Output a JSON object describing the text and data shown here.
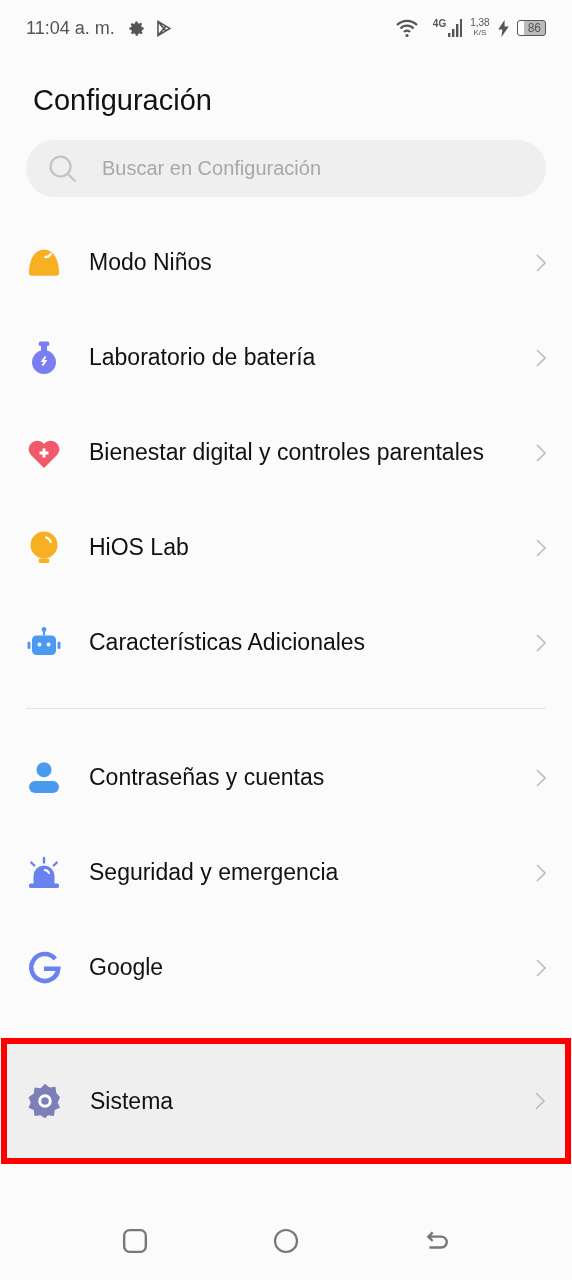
{
  "status_bar": {
    "time": "11:04 a. m.",
    "network": "4G",
    "speed_value": "1,38",
    "speed_unit": "K/S",
    "battery": "86"
  },
  "title": "Configuración",
  "search": {
    "placeholder": "Buscar en Configuración"
  },
  "groups": [
    {
      "items": [
        {
          "label": "Modo Niños",
          "kind": "kids",
          "selected": false
        },
        {
          "label": "Laboratorio de batería",
          "kind": "battery",
          "selected": false
        },
        {
          "label": "Bienestar digital y controles parentales",
          "kind": "heart",
          "selected": false
        },
        {
          "label": "HiOS Lab",
          "kind": "bulb",
          "selected": false
        },
        {
          "label": "Características Adicionales",
          "kind": "robot",
          "selected": false
        }
      ]
    },
    {
      "items": [
        {
          "label": "Contraseñas y cuentas",
          "kind": "person",
          "selected": false
        },
        {
          "label": "Seguridad y emergencia",
          "kind": "siren",
          "selected": false
        },
        {
          "label": "Google",
          "kind": "google",
          "selected": false
        }
      ]
    },
    {
      "items": [
        {
          "label": "Sistema",
          "kind": "gear",
          "selected": true
        }
      ]
    }
  ]
}
